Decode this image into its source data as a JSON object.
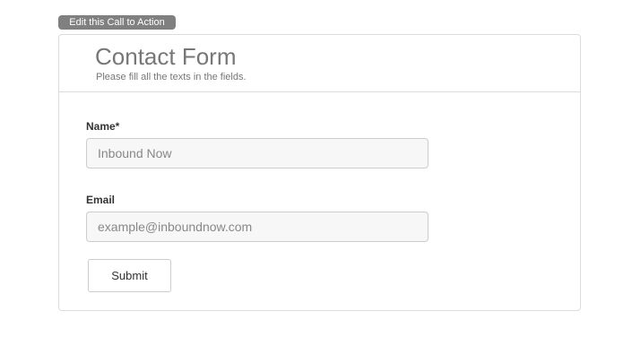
{
  "edit_cta": {
    "label": "Edit this Call to Action"
  },
  "form": {
    "title": "Contact Form",
    "subtitle": "Please fill all the texts in the fields.",
    "fields": [
      {
        "label": "Name*",
        "value": "",
        "placeholder": "Inbound Now"
      },
      {
        "label": "Email",
        "value": "",
        "placeholder": "example@inboundnow.com"
      }
    ],
    "submit_label": "Submit"
  },
  "colors": {
    "edit_button_bg": "#808080",
    "title_text": "#777777",
    "card_border": "#dcdcdc",
    "input_bg": "#f7f7f7"
  }
}
